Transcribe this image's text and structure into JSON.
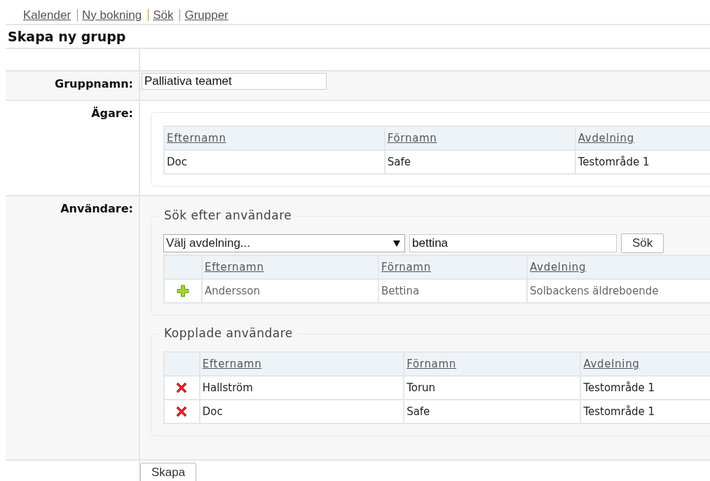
{
  "nav": [
    {
      "label": "Kalender"
    },
    {
      "label": "Ny bokning"
    },
    {
      "label": "Sök"
    },
    {
      "label": "Grupper"
    }
  ],
  "title": "Skapa ny grupp",
  "group_name": {
    "label": "Gruppnamn:",
    "value": "Palliativa teamet"
  },
  "owner": {
    "label": "Ägare:",
    "columns": [
      "Efternamn",
      "Förnamn",
      "Avdelning"
    ],
    "rows": [
      [
        "Doc",
        "Safe",
        "Testområde 1"
      ]
    ]
  },
  "users": {
    "label": "Användare:",
    "search": {
      "legend": "Sök efter användare",
      "department": "Välj avdelning...",
      "query": "bettina",
      "button": "Sök",
      "columns": [
        "Efternamn",
        "Förnamn",
        "Avdelning"
      ],
      "rows": [
        [
          "Andersson",
          "Bettina",
          "Solbackens äldreboende"
        ]
      ]
    },
    "linked": {
      "legend": "Kopplade användare",
      "columns": [
        "Efternamn",
        "Förnamn",
        "Avdelning"
      ],
      "rows": [
        [
          "Hallström",
          "Torun",
          "Testområde 1"
        ],
        [
          "Doc",
          "Safe",
          "Testområde 1"
        ]
      ]
    }
  },
  "submit": "Skapa"
}
